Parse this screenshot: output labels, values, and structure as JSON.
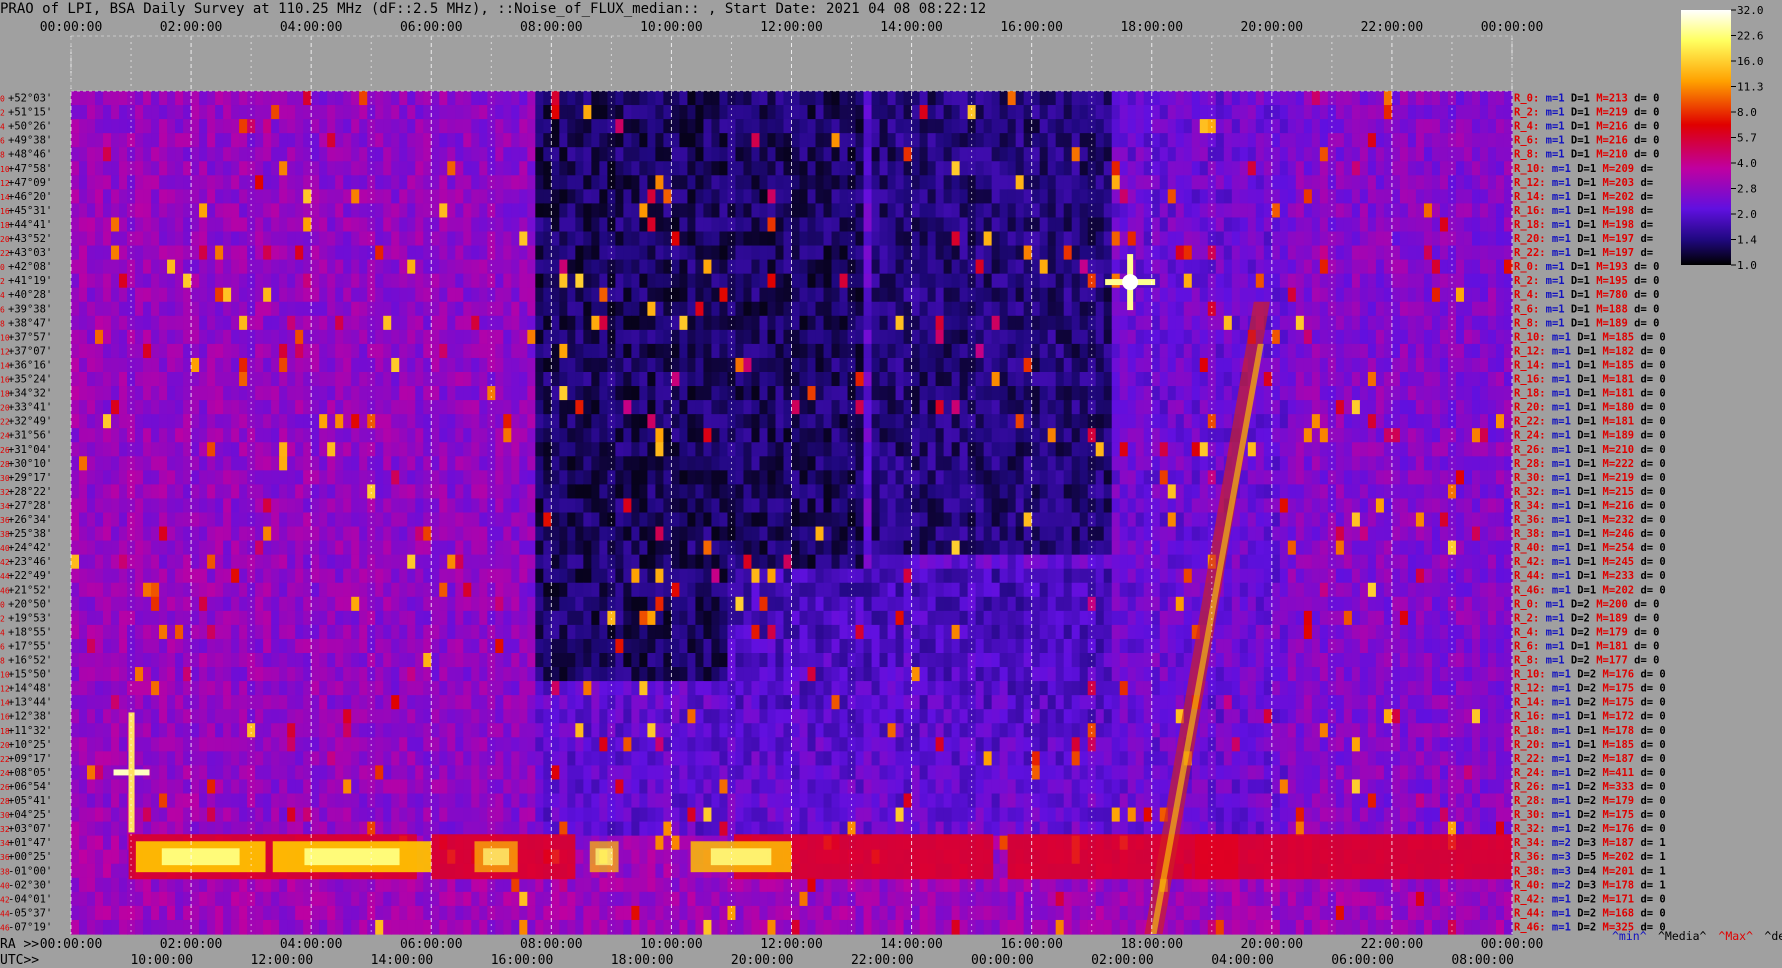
{
  "title": "PRAO of LPI, BSA Daily Survey at 110.25 MHz (dF::2.5 MHz), ::Noise_of_FLUX_median:: , Start Date: 2021 04 08 08:22:12",
  "chart_data": {
    "type": "heatmap",
    "title": "PRAO of LPI, BSA Daily Survey at 110.25 MHz (dF::2.5 MHz), ::Noise_of_FLUX_median:: , Start Date: 2021 04 08 08:22:12",
    "top_axis_ticks": [
      "00:00:00",
      "02:00:00",
      "04:00:00",
      "06:00:00",
      "08:00:00",
      "10:00:00",
      "12:00:00",
      "14:00:00",
      "16:00:00",
      "18:00:00",
      "20:00:00",
      "22:00:00",
      "00:00:00"
    ],
    "bottom_ra_prefix": "RA >>",
    "bottom_ra_ticks": [
      "00:00:00",
      "02:00:00",
      "04:00:00",
      "06:00:00",
      "08:00:00",
      "10:00:00",
      "12:00:00",
      "14:00:00",
      "16:00:00",
      "18:00:00",
      "20:00:00",
      "22:00:00",
      "00:00:00"
    ],
    "bottom_utc_prefix": "UTC>>",
    "bottom_utc_ticks": [
      "10:00:00",
      "12:00:00",
      "14:00:00",
      "16:00:00",
      "18:00:00",
      "20:00:00",
      "22:00:00",
      "00:00:00",
      "02:00:00",
      "04:00:00",
      "06:00:00",
      "08:00:00"
    ],
    "colorbar_ticks": [
      "32.0",
      "22.6",
      "16.0",
      "11.3",
      "8.0",
      "5.7",
      "4.0",
      "2.8",
      "2.0",
      "1.4",
      "1.0"
    ],
    "colorbar_range": [
      1.0,
      32.0
    ],
    "colorbar_scale": "log",
    "declinations": [
      "+52°03'",
      "+51°15'",
      "+50°26'",
      "+49°38'",
      "+48°46'",
      "+47°58'",
      "+47°09'",
      "+46°20'",
      "+45°31'",
      "+44°41'",
      "+43°52'",
      "+43°03'",
      "+42°08'",
      "+41°19'",
      "+40°28'",
      "+39°38'",
      "+38°47'",
      "+37°57'",
      "+37°07'",
      "+36°16'",
      "+35°24'",
      "+34°32'",
      "+33°41'",
      "+32°49'",
      "+31°56'",
      "+31°04'",
      "+30°10'",
      "+29°17'",
      "+28°22'",
      "+27°28'",
      "+26°34'",
      "+25°38'",
      "+24°42'",
      "+23°46'",
      "+22°49'",
      "+21°52'",
      "+20°50'",
      "+19°53'",
      "+18°55'",
      "+17°55'",
      "+16°52'",
      "+15°50'",
      "+14°48'",
      "+13°44'",
      "+12°38'",
      "+11°32'",
      "+10°25'",
      "+09°17'",
      "+08°05'",
      "+06°54'",
      "+05°41'",
      "+04°25'",
      "+03°07'",
      "+01°47'",
      "+00°25'",
      "-01°00'",
      "-02°30'",
      "-04°01'",
      "-05°37'",
      "-07°19'"
    ],
    "row_numbers": [
      "0",
      "2",
      "4",
      "6",
      "8",
      "10",
      "12",
      "14",
      "16",
      "18",
      "20",
      "22",
      "0",
      "2",
      "4",
      "6",
      "8",
      "10",
      "12",
      "14",
      "16",
      "18",
      "20",
      "22",
      "24",
      "26",
      "28",
      "30",
      "32",
      "34",
      "36",
      "38",
      "40",
      "42",
      "44",
      "46",
      "0",
      "2",
      "4",
      "6",
      "8",
      "10",
      "12",
      "14",
      "16",
      "18",
      "20",
      "22",
      "24",
      "26",
      "28",
      "30",
      "32",
      "34",
      "36",
      "38",
      "40",
      "42",
      "44",
      "46"
    ],
    "row_stats": [
      {
        "r": "R_0:",
        "m": "m=1",
        "D": "D=1",
        "M": "M=213",
        "d": "d= 0"
      },
      {
        "r": "R_2:",
        "m": "m=1",
        "D": "D=1",
        "M": "M=219",
        "d": "d= 0"
      },
      {
        "r": "R_4:",
        "m": "m=1",
        "D": "D=1",
        "M": "M=216",
        "d": "d= 0"
      },
      {
        "r": "R_6:",
        "m": "m=1",
        "D": "D=1",
        "M": "M=216",
        "d": "d= 0"
      },
      {
        "r": "R_8:",
        "m": "m=1",
        "D": "D=1",
        "M": "M=210",
        "d": "d= 0"
      },
      {
        "r": "R_10:",
        "m": "m=1",
        "D": "D=1",
        "M": "M=209",
        "d": "d="
      },
      {
        "r": "R_12:",
        "m": "m=1",
        "D": "D=1",
        "M": "M=203",
        "d": "d="
      },
      {
        "r": "R_14:",
        "m": "m=1",
        "D": "D=1",
        "M": "M=202",
        "d": "d="
      },
      {
        "r": "R_16:",
        "m": "m=1",
        "D": "D=1",
        "M": "M=198",
        "d": "d="
      },
      {
        "r": "R_18:",
        "m": "m=1",
        "D": "D=1",
        "M": "M=198",
        "d": "d="
      },
      {
        "r": "R_20:",
        "m": "m=1",
        "D": "D=1",
        "M": "M=197",
        "d": "d="
      },
      {
        "r": "R_22:",
        "m": "m=1",
        "D": "D=1",
        "M": "M=197",
        "d": "d="
      },
      {
        "r": "R_0:",
        "m": "m=1",
        "D": "D=1",
        "M": "M=193",
        "d": "d= 0"
      },
      {
        "r": "R_2:",
        "m": "m=1",
        "D": "D=1",
        "M": "M=195",
        "d": "d= 0"
      },
      {
        "r": "R_4:",
        "m": "m=1",
        "D": "D=1",
        "M": "M=780",
        "d": "d= 0"
      },
      {
        "r": "R_6:",
        "m": "m=1",
        "D": "D=1",
        "M": "M=188",
        "d": "d= 0"
      },
      {
        "r": "R_8:",
        "m": "m=1",
        "D": "D=1",
        "M": "M=189",
        "d": "d= 0"
      },
      {
        "r": "R_10:",
        "m": "m=1",
        "D": "D=1",
        "M": "M=185",
        "d": "d= 0"
      },
      {
        "r": "R_12:",
        "m": "m=1",
        "D": "D=1",
        "M": "M=182",
        "d": "d= 0"
      },
      {
        "r": "R_14:",
        "m": "m=1",
        "D": "D=1",
        "M": "M=185",
        "d": "d= 0"
      },
      {
        "r": "R_16:",
        "m": "m=1",
        "D": "D=1",
        "M": "M=181",
        "d": "d= 0"
      },
      {
        "r": "R_18:",
        "m": "m=1",
        "D": "D=1",
        "M": "M=181",
        "d": "d= 0"
      },
      {
        "r": "R_20:",
        "m": "m=1",
        "D": "D=1",
        "M": "M=180",
        "d": "d= 0"
      },
      {
        "r": "R_22:",
        "m": "m=1",
        "D": "D=1",
        "M": "M=181",
        "d": "d= 0"
      },
      {
        "r": "R_24:",
        "m": "m=1",
        "D": "D=1",
        "M": "M=189",
        "d": "d= 0"
      },
      {
        "r": "R_26:",
        "m": "m=1",
        "D": "D=1",
        "M": "M=210",
        "d": "d= 0"
      },
      {
        "r": "R_28:",
        "m": "m=1",
        "D": "D=1",
        "M": "M=222",
        "d": "d= 0"
      },
      {
        "r": "R_30:",
        "m": "m=1",
        "D": "D=1",
        "M": "M=219",
        "d": "d= 0"
      },
      {
        "r": "R_32:",
        "m": "m=1",
        "D": "D=1",
        "M": "M=215",
        "d": "d= 0"
      },
      {
        "r": "R_34:",
        "m": "m=1",
        "D": "D=1",
        "M": "M=216",
        "d": "d= 0"
      },
      {
        "r": "R_36:",
        "m": "m=1",
        "D": "D=1",
        "M": "M=232",
        "d": "d= 0"
      },
      {
        "r": "R_38:",
        "m": "m=1",
        "D": "D=1",
        "M": "M=246",
        "d": "d= 0"
      },
      {
        "r": "R_40:",
        "m": "m=1",
        "D": "D=1",
        "M": "M=254",
        "d": "d= 0"
      },
      {
        "r": "R_42:",
        "m": "m=1",
        "D": "D=1",
        "M": "M=245",
        "d": "d= 0"
      },
      {
        "r": "R_44:",
        "m": "m=1",
        "D": "D=1",
        "M": "M=233",
        "d": "d= 0"
      },
      {
        "r": "R_46:",
        "m": "m=1",
        "D": "D=1",
        "M": "M=202",
        "d": "d= 0"
      },
      {
        "r": "R_0:",
        "m": "m=1",
        "D": "D=2",
        "M": "M=200",
        "d": "d= 0"
      },
      {
        "r": "R_2:",
        "m": "m=1",
        "D": "D=2",
        "M": "M=189",
        "d": "d= 0"
      },
      {
        "r": "R_4:",
        "m": "m=1",
        "D": "D=2",
        "M": "M=179",
        "d": "d= 0"
      },
      {
        "r": "R_6:",
        "m": "m=1",
        "D": "D=1",
        "M": "M=181",
        "d": "d= 0"
      },
      {
        "r": "R_8:",
        "m": "m=1",
        "D": "D=2",
        "M": "M=177",
        "d": "d= 0"
      },
      {
        "r": "R_10:",
        "m": "m=1",
        "D": "D=2",
        "M": "M=176",
        "d": "d= 0"
      },
      {
        "r": "R_12:",
        "m": "m=1",
        "D": "D=2",
        "M": "M=175",
        "d": "d= 0"
      },
      {
        "r": "R_14:",
        "m": "m=1",
        "D": "D=2",
        "M": "M=175",
        "d": "d= 0"
      },
      {
        "r": "R_16:",
        "m": "m=1",
        "D": "D=1",
        "M": "M=172",
        "d": "d= 0"
      },
      {
        "r": "R_18:",
        "m": "m=1",
        "D": "D=1",
        "M": "M=178",
        "d": "d= 0"
      },
      {
        "r": "R_20:",
        "m": "m=1",
        "D": "D=1",
        "M": "M=185",
        "d": "d= 0"
      },
      {
        "r": "R_22:",
        "m": "m=1",
        "D": "D=2",
        "M": "M=187",
        "d": "d= 0"
      },
      {
        "r": "R_24:",
        "m": "m=1",
        "D": "D=2",
        "M": "M=411",
        "d": "d= 0"
      },
      {
        "r": "R_26:",
        "m": "m=1",
        "D": "D=2",
        "M": "M=333",
        "d": "d= 0"
      },
      {
        "r": "R_28:",
        "m": "m=1",
        "D": "D=2",
        "M": "M=179",
        "d": "d= 0"
      },
      {
        "r": "R_30:",
        "m": "m=1",
        "D": "D=2",
        "M": "M=175",
        "d": "d= 0"
      },
      {
        "r": "R_32:",
        "m": "m=1",
        "D": "D=2",
        "M": "M=176",
        "d": "d= 0"
      },
      {
        "r": "R_34:",
        "m": "m=2",
        "D": "D=3",
        "M": "M=187",
        "d": "d= 1"
      },
      {
        "r": "R_36:",
        "m": "m=3",
        "D": "D=5",
        "M": "M=202",
        "d": "d= 1"
      },
      {
        "r": "R_38:",
        "m": "m=3",
        "D": "D=4",
        "M": "M=201",
        "d": "d= 1"
      },
      {
        "r": "R_40:",
        "m": "m=2",
        "D": "D=3",
        "M": "M=178",
        "d": "d= 1"
      },
      {
        "r": "R_42:",
        "m": "m=1",
        "D": "D=2",
        "M": "M=171",
        "d": "d= 0"
      },
      {
        "r": "R_44:",
        "m": "m=1",
        "D": "D=2",
        "M": "M=168",
        "d": "d= 0"
      },
      {
        "r": "R_46:",
        "m": "m=1",
        "D": "D=2",
        "M": "M=325",
        "d": "d= 0"
      }
    ],
    "legend_keys": [
      "^min^",
      "^Media^",
      "^Max^",
      "^devia^"
    ],
    "legend_colors": [
      "#1010c0",
      "#000000",
      "#e00000",
      "#000000"
    ]
  }
}
